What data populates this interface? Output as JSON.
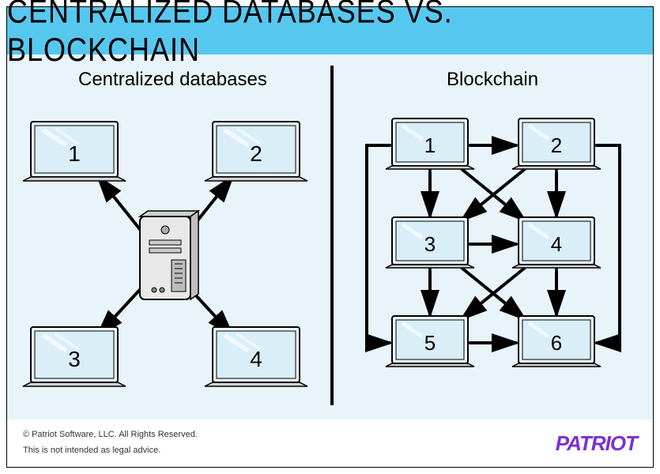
{
  "title": "CENTRALIZED DATABASES VS. BLOCKCHAIN",
  "left": {
    "label": "Centralized databases",
    "nodes": [
      "1",
      "2",
      "3",
      "4"
    ]
  },
  "right": {
    "label": "Blockchain",
    "nodes": [
      "1",
      "2",
      "3",
      "4",
      "5",
      "6"
    ]
  },
  "footer": {
    "copyright": "© Patriot Software, LLC. All Rights Reserved.",
    "disclaimer": "This is not intended as legal advice.",
    "brand": "PATRIOT"
  }
}
